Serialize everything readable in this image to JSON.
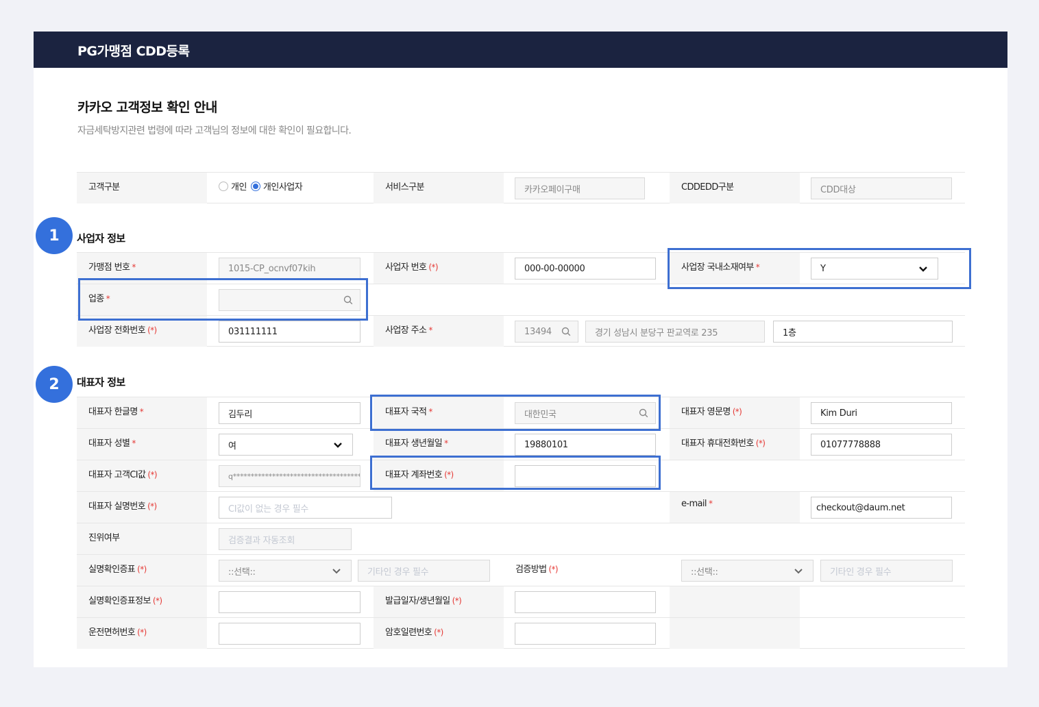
{
  "header": {
    "title": "PG가맹점 CDD등록"
  },
  "intro": {
    "title": "카카오 고객정보 확인 안내",
    "subtitle": "자금세탁방지관련 법령에 따라 고객님의 정보에 대한 확인이 필요합니다."
  },
  "customer": {
    "type_label": "고객구분",
    "type_options": [
      "개인",
      "개인사업자"
    ],
    "type_selected": "개인사업자",
    "service_label": "서비스구분",
    "service_value": "카카오페이구매",
    "cdd_label": "CDDEDD구분",
    "cdd_value": "CDD대상"
  },
  "business": {
    "badge": "1",
    "title": "사업자 정보",
    "merchant_no_label": "가맹점 번호",
    "merchant_no_value": "1015-CP_ocnvf07kih",
    "biz_no_label": "사업자 번호",
    "biz_no_value": "000-00-00000",
    "domestic_label": "사업장 국내소재여부",
    "domestic_value": "Y",
    "industry_label": "업종",
    "industry_value": "",
    "phone_label": "사업장 전화번호",
    "phone_value": "031111111",
    "address_label": "사업장 주소",
    "zip": "13494",
    "address": "경기 성남시 분당구 판교역로 235",
    "address_detail": "1층"
  },
  "rep": {
    "badge": "2",
    "title": "대표자 정보",
    "name_ko_label": "대표자 한글명",
    "name_ko_value": "김두리",
    "nationality_label": "대표자 국적",
    "nationality_value": "대한민국",
    "name_en_label": "대표자 영문명",
    "name_en_value": "Kim Duri",
    "gender_label": "대표자 성별",
    "gender_value": "여",
    "birth_label": "대표자 생년월일",
    "birth_value": "19880101",
    "mobile_label": "대표자 휴대전화번호",
    "mobile_value": "01077778888",
    "ci_label": "대표자 고객CI값",
    "ci_value": "q**************************************",
    "account_label": "대표자 계좌번호",
    "account_value": "",
    "realname_label": "대표자 실명번호",
    "realname_placeholder": "CI값이 없는 경우 필수",
    "email_label": "e-mail",
    "email_value": "checkout@daum.net",
    "authenticity_label": "진위여부",
    "authenticity_placeholder": "검증결과 자동조회",
    "id_doc_label": "실명확인증표",
    "id_doc_select": "::선택::",
    "id_doc_other_placeholder": "기타인 경우 필수",
    "verify_label": "검증방법",
    "verify_select": "::선택::",
    "verify_other_placeholder": "기타인 경우 필수",
    "id_doc_info_label": "실명확인증표정보",
    "issue_date_label": "발급일자/생년월일",
    "license_label": "운전면허번호",
    "serial_label": "암호일련번호"
  },
  "marks": {
    "required": "*",
    "conditional": "(*)"
  },
  "colors": {
    "header_bg": "#1b2340",
    "accent": "#3470dc",
    "required": "#e53935"
  }
}
